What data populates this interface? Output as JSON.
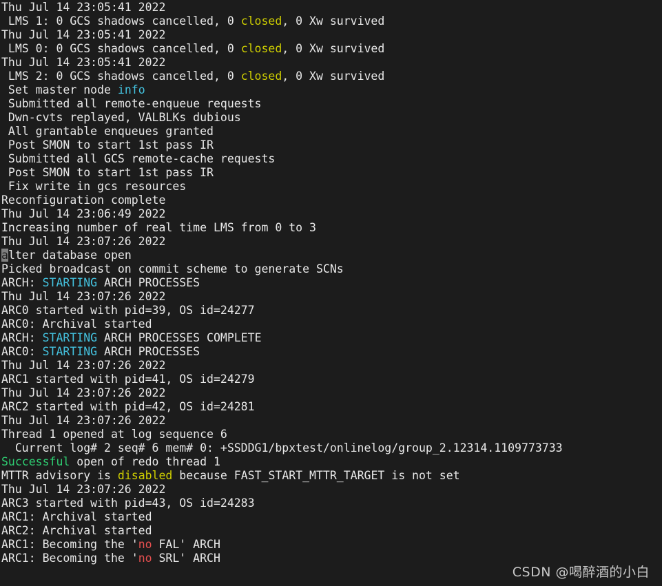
{
  "terminal": {
    "background_color": "#1c1c1c",
    "foreground_color": "#e8e8e8",
    "accent_colors": {
      "yellow": "#cfcf00",
      "cyan": "#44c3e0",
      "green": "#2ecc71",
      "red": "#e85050",
      "cursor_background": "#7f7f7f"
    },
    "lines": [
      {
        "id": "line-1",
        "segments": [
          {
            "text": "Thu Jul 14 23:05:41 2022",
            "color": "default"
          }
        ]
      },
      {
        "id": "line-2",
        "segments": [
          {
            "text": " LMS 1: 0 GCS shadows cancelled, 0 ",
            "color": "default"
          },
          {
            "text": "closed",
            "color": "yellow"
          },
          {
            "text": ", 0 Xw survived",
            "color": "default"
          }
        ]
      },
      {
        "id": "line-3",
        "segments": [
          {
            "text": "Thu Jul 14 23:05:41 2022",
            "color": "default"
          }
        ]
      },
      {
        "id": "line-4",
        "segments": [
          {
            "text": " LMS 0: 0 GCS shadows cancelled, 0 ",
            "color": "default"
          },
          {
            "text": "closed",
            "color": "yellow"
          },
          {
            "text": ", 0 Xw survived",
            "color": "default"
          }
        ]
      },
      {
        "id": "line-5",
        "segments": [
          {
            "text": "Thu Jul 14 23:05:41 2022",
            "color": "default"
          }
        ]
      },
      {
        "id": "line-6",
        "segments": [
          {
            "text": " LMS 2: 0 GCS shadows cancelled, 0 ",
            "color": "default"
          },
          {
            "text": "closed",
            "color": "yellow"
          },
          {
            "text": ", 0 Xw survived",
            "color": "default"
          }
        ]
      },
      {
        "id": "line-7",
        "segments": [
          {
            "text": " Set master node ",
            "color": "default"
          },
          {
            "text": "info",
            "color": "cyan"
          }
        ]
      },
      {
        "id": "line-8",
        "segments": [
          {
            "text": " Submitted all remote-enqueue requests",
            "color": "default"
          }
        ]
      },
      {
        "id": "line-9",
        "segments": [
          {
            "text": " Dwn-cvts replayed, VALBLKs dubious",
            "color": "default"
          }
        ]
      },
      {
        "id": "line-10",
        "segments": [
          {
            "text": " All grantable enqueues granted",
            "color": "default"
          }
        ]
      },
      {
        "id": "line-11",
        "segments": [
          {
            "text": " Post SMON to start 1st pass IR",
            "color": "default"
          }
        ]
      },
      {
        "id": "line-12",
        "segments": [
          {
            "text": " Submitted all GCS remote-cache requests",
            "color": "default"
          }
        ]
      },
      {
        "id": "line-13",
        "segments": [
          {
            "text": " Post SMON to start 1st pass IR",
            "color": "default"
          }
        ]
      },
      {
        "id": "line-14",
        "segments": [
          {
            "text": " Fix write in gcs resources",
            "color": "default"
          }
        ]
      },
      {
        "id": "line-15",
        "segments": [
          {
            "text": "Reconfiguration complete",
            "color": "default"
          }
        ]
      },
      {
        "id": "line-16",
        "segments": [
          {
            "text": "Thu Jul 14 23:06:49 2022",
            "color": "default"
          }
        ]
      },
      {
        "id": "line-17",
        "segments": [
          {
            "text": "Increasing number of real time LMS from 0 to 3",
            "color": "default"
          }
        ]
      },
      {
        "id": "line-18",
        "segments": [
          {
            "text": "Thu Jul 14 23:07:26 2022",
            "color": "default"
          }
        ]
      },
      {
        "id": "line-19",
        "segments": [
          {
            "text": "a",
            "color": "default",
            "cursor": true
          },
          {
            "text": "lter database open",
            "color": "default"
          }
        ]
      },
      {
        "id": "line-20",
        "segments": [
          {
            "text": "Picked broadcast on commit scheme to generate SCNs",
            "color": "default"
          }
        ]
      },
      {
        "id": "line-21",
        "segments": [
          {
            "text": "ARCH: ",
            "color": "default"
          },
          {
            "text": "STARTING",
            "color": "cyan"
          },
          {
            "text": " ARCH PROCESSES",
            "color": "default"
          }
        ]
      },
      {
        "id": "line-22",
        "segments": [
          {
            "text": "Thu Jul 14 23:07:26 2022",
            "color": "default"
          }
        ]
      },
      {
        "id": "line-23",
        "segments": [
          {
            "text": "ARC0 started with pid=39, OS id=24277",
            "color": "default"
          }
        ]
      },
      {
        "id": "line-24",
        "segments": [
          {
            "text": "ARC0: Archival started",
            "color": "default"
          }
        ]
      },
      {
        "id": "line-25",
        "segments": [
          {
            "text": "ARCH: ",
            "color": "default"
          },
          {
            "text": "STARTING",
            "color": "cyan"
          },
          {
            "text": " ARCH PROCESSES COMPLETE",
            "color": "default"
          }
        ]
      },
      {
        "id": "line-26",
        "segments": [
          {
            "text": "ARC0: ",
            "color": "default"
          },
          {
            "text": "STARTING",
            "color": "cyan"
          },
          {
            "text": " ARCH PROCESSES",
            "color": "default"
          }
        ]
      },
      {
        "id": "line-27",
        "segments": [
          {
            "text": "Thu Jul 14 23:07:26 2022",
            "color": "default"
          }
        ]
      },
      {
        "id": "line-28",
        "segments": [
          {
            "text": "ARC1 started with pid=41, OS id=24279",
            "color": "default"
          }
        ]
      },
      {
        "id": "line-29",
        "segments": [
          {
            "text": "Thu Jul 14 23:07:26 2022",
            "color": "default"
          }
        ]
      },
      {
        "id": "line-30",
        "segments": [
          {
            "text": "ARC2 started with pid=42, OS id=24281",
            "color": "default"
          }
        ]
      },
      {
        "id": "line-31",
        "segments": [
          {
            "text": "Thu Jul 14 23:07:26 2022",
            "color": "default"
          }
        ]
      },
      {
        "id": "line-32",
        "segments": [
          {
            "text": "Thread 1 opened at log sequence 6",
            "color": "default"
          }
        ]
      },
      {
        "id": "line-33",
        "segments": [
          {
            "text": "  Current log# 2 seq# 6 mem# 0: +SSDDG1/bpxtest/onlinelog/group_2.12314.1109773733",
            "color": "default"
          }
        ]
      },
      {
        "id": "line-34",
        "segments": [
          {
            "text": "Successful",
            "color": "green"
          },
          {
            "text": " open of redo thread 1",
            "color": "default"
          }
        ]
      },
      {
        "id": "line-35",
        "segments": [
          {
            "text": "MTTR advisory is ",
            "color": "default"
          },
          {
            "text": "disabled",
            "color": "yellow"
          },
          {
            "text": " because FAST_START_MTTR_TARGET is not set",
            "color": "default"
          }
        ]
      },
      {
        "id": "line-36",
        "segments": [
          {
            "text": "Thu Jul 14 23:07:26 2022",
            "color": "default"
          }
        ]
      },
      {
        "id": "line-37",
        "segments": [
          {
            "text": "ARC3 started with pid=43, OS id=24283",
            "color": "default"
          }
        ]
      },
      {
        "id": "line-38",
        "segments": [
          {
            "text": "ARC1: Archival started",
            "color": "default"
          }
        ]
      },
      {
        "id": "line-39",
        "segments": [
          {
            "text": "ARC2: Archival started",
            "color": "default"
          }
        ]
      },
      {
        "id": "line-40",
        "segments": [
          {
            "text": "ARC1: Becoming the '",
            "color": "default"
          },
          {
            "text": "no",
            "color": "red"
          },
          {
            "text": " FAL' ARCH",
            "color": "default"
          }
        ]
      },
      {
        "id": "line-41",
        "segments": [
          {
            "text": "ARC1: Becoming the '",
            "color": "default"
          },
          {
            "text": "no",
            "color": "red"
          },
          {
            "text": " SRL' ARCH",
            "color": "default"
          }
        ]
      }
    ]
  },
  "watermark": {
    "text": "CSDN @喝醉酒的小白"
  }
}
